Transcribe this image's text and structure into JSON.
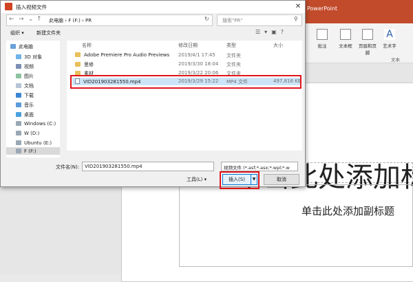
{
  "powerpoint": {
    "app_title": "PowerPoint",
    "ribbon": [
      {
        "label": "批注"
      },
      {
        "label": "文本框"
      },
      {
        "label": "页眉和页脚"
      },
      {
        "label": "艺术字"
      }
    ],
    "group_label": "文本",
    "slide_title_placeholder": "单击此处添加标",
    "slide_subtitle_placeholder": "单击此处添加副标题"
  },
  "dialog": {
    "title": "插入视频文件",
    "breadcrumb": "此电脑 › F (F:) › PR",
    "search_placeholder": "搜索\"PR\"",
    "toolbar": {
      "organize": "组织 ▾",
      "new_folder": "新建文件夹"
    },
    "nav": [
      {
        "label": "此电脑",
        "icon": "computer-icon"
      },
      {
        "label": "3D 对象",
        "icon": "3d-objects-icon"
      },
      {
        "label": "视频",
        "icon": "video-folder-icon"
      },
      {
        "label": "图片",
        "icon": "pictures-icon"
      },
      {
        "label": "文档",
        "icon": "documents-icon"
      },
      {
        "label": "下载",
        "icon": "download-icon"
      },
      {
        "label": "音乐",
        "icon": "music-icon"
      },
      {
        "label": "桌面",
        "icon": "desktop-icon"
      },
      {
        "label": "Windows (C:)",
        "icon": "drive-icon"
      },
      {
        "label": "W (D:)",
        "icon": "drive-icon"
      },
      {
        "label": "Ubuntu (E:)",
        "icon": "drive-icon"
      },
      {
        "label": "F (F:)",
        "icon": "drive-icon"
      }
    ],
    "columns": {
      "name": "名称",
      "date": "修改日期",
      "type": "类型",
      "size": "大小"
    },
    "files": [
      {
        "name": "Adobe Premiere Pro Audio Previews",
        "date": "2019/4/1 17:45",
        "type": "文件夹",
        "size": ""
      },
      {
        "name": "思修",
        "date": "2019/3/30 18:04",
        "type": "文件夹",
        "size": ""
      },
      {
        "name": "素材",
        "date": "2019/3/22 20:06",
        "type": "文件夹",
        "size": ""
      },
      {
        "name": "VID201903281550.mp4",
        "date": "2019/3/29 15:22",
        "type": "MP4 文件",
        "size": "497,816 KB"
      }
    ],
    "filename_label": "文件名(N):",
    "filename_value": "VID201903281550.mp4",
    "filter_value": "视频文件 (*.asf;*.asx;*.wpl;*.w",
    "tools_label": "工具(L)   ▾",
    "insert_label": "插入(S)",
    "cancel_label": "取消"
  }
}
